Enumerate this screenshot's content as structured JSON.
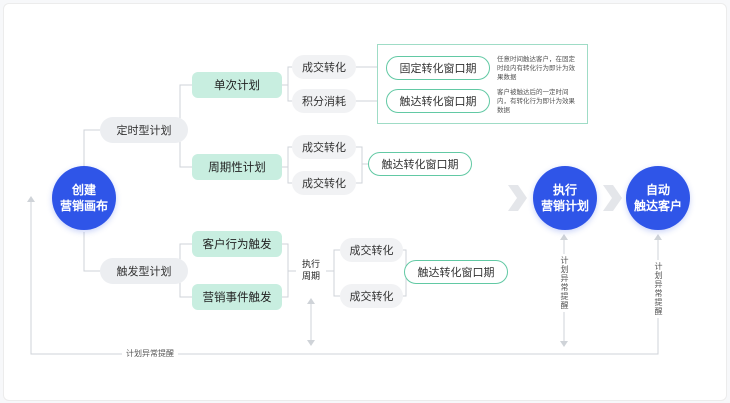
{
  "nodes": {
    "create": [
      "创建",
      "营销画布"
    ],
    "timed_plan": "定时型计划",
    "triggered_plan": "触发型计划",
    "single_plan": "单次计划",
    "periodic_plan": "周期性计划",
    "customer_trigger": "客户行为触发",
    "marketing_trigger": "营销事件触发",
    "deal_1": "成交转化",
    "points": "积分消耗",
    "deal_2": "成交转化",
    "deal_3": "成交转化",
    "deal_4": "成交转化",
    "deal_5": "成交转化",
    "fixed_window": "固定转化窗口期",
    "reach_window_1": "触达转化窗口期",
    "reach_window_2": "触达转化窗口期",
    "reach_window_3": "触达转化窗口期",
    "exec_cycle": [
      "执行",
      "周期"
    ],
    "execute": [
      "执行",
      "营销计划"
    ],
    "auto_reach": [
      "自动",
      "触达客户"
    ]
  },
  "notes": {
    "fixed": "任意时间触达客户，在固定时段内有转化行为即计为效果数据",
    "reach": "客户被触达后的一定时间内，有转化行为即计为效果数据"
  },
  "alerts": {
    "bottom": "计划异常提醒",
    "execute": "计划异常提醒",
    "auto": "计划异常提醒"
  },
  "colors": {
    "primary": "#2f55e8",
    "green_fill": "#c8eee0",
    "green_border": "#62c9a4",
    "gray_fill": "#eceef1",
    "line": "#cfd3d8"
  }
}
